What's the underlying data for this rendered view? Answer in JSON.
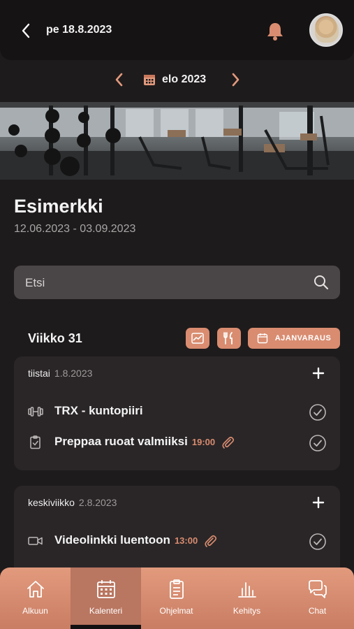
{
  "header": {
    "date_title": "pe 18.8.2023"
  },
  "month_nav": {
    "label": "elo 2023"
  },
  "program": {
    "title": "Esimerkki",
    "dates": "12.06.2023 - 03.09.2023"
  },
  "search": {
    "placeholder": "Etsi"
  },
  "week": {
    "label": "Viikko 31",
    "booking_label": "AJANVARAUS"
  },
  "days": [
    {
      "name": "tiistai",
      "date": "1.8.2023",
      "tasks": [
        {
          "title": "TRX - kuntopiiri",
          "time": "",
          "icon": "dumbbell-icon",
          "attachment": false
        },
        {
          "title": "Preppaa ruoat valmiiksi",
          "time": "19:00",
          "icon": "clipboard-check-icon",
          "attachment": true
        }
      ]
    },
    {
      "name": "keskiviikko",
      "date": "2.8.2023",
      "tasks": [
        {
          "title": "Videolinkki luentoon",
          "time": "13:00",
          "icon": "video-camera-icon",
          "attachment": true
        }
      ]
    }
  ],
  "tabs": [
    {
      "label": "Alkuun",
      "icon": "home-icon",
      "active": false
    },
    {
      "label": "Kalenteri",
      "icon": "calendar-icon",
      "active": true
    },
    {
      "label": "Ohjelmat",
      "icon": "clipboard-icon",
      "active": false
    },
    {
      "label": "Kehitys",
      "icon": "bar-chart-icon",
      "active": false
    },
    {
      "label": "Chat",
      "icon": "chat-bubbles-icon",
      "active": false
    }
  ],
  "colors": {
    "accent": "#d98c70",
    "background": "#1e1b1c",
    "card": "#2a2627",
    "tabbar": "#d98c70"
  }
}
